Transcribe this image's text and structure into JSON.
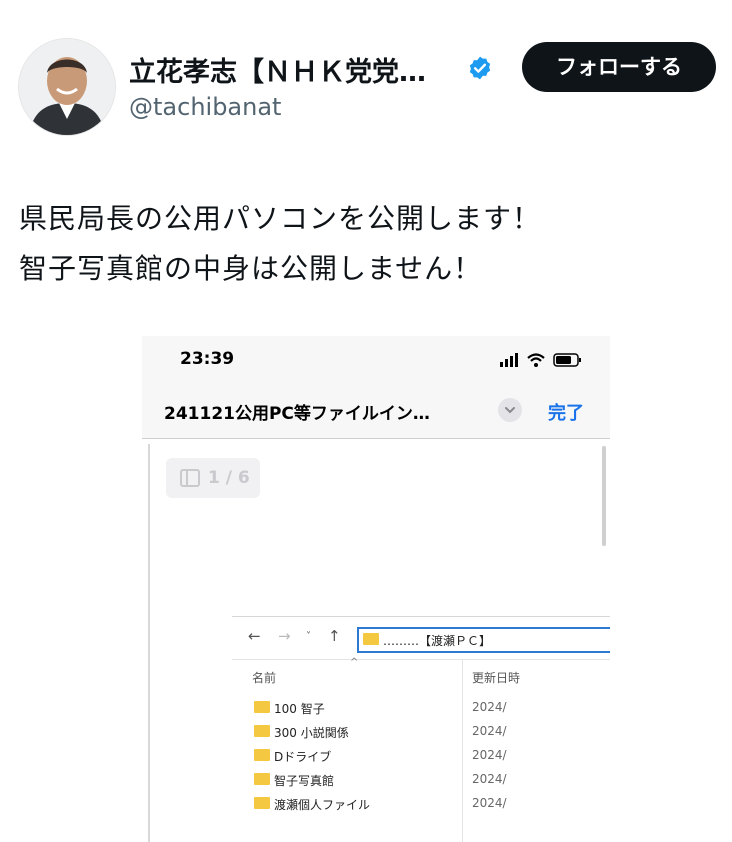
{
  "header": {
    "display_name": "立花孝志【ＮＨＫ党党…",
    "handle": "@tachibanat",
    "follow_label": "フォローする"
  },
  "tweet": {
    "line1": "県民局長の公用パソコンを公開します！",
    "line2": "智子写真館の中身は公開しません！"
  },
  "screenshot": {
    "time": "23:39",
    "doc_title": "241121公用PC等ファイルイン…",
    "done_label": "完了",
    "page_indicator": "1 / 6",
    "explorer": {
      "path": "………【渡瀬ＰＣ】",
      "col_name": "名前",
      "col_date": "更新日時",
      "rows": [
        {
          "name": "100 智子",
          "date": "2024/"
        },
        {
          "name": "300 小説関係",
          "date": "2024/"
        },
        {
          "name": "Dドライブ",
          "date": "2024/"
        },
        {
          "name": "智子写真館",
          "date": "2024/"
        },
        {
          "name": "渡瀬個人ファイル",
          "date": "2024/"
        }
      ]
    }
  },
  "colors": {
    "follow_bg": "#0f1419",
    "verified_blue": "#1d9bf0",
    "link_blue": "#1a73e8",
    "folder_yellow": "#f5c842"
  },
  "icons": [
    "verified-badge-icon",
    "signal-icon",
    "wifi-icon",
    "battery-icon",
    "chevron-down-icon",
    "sidebar-icon",
    "folder-icon",
    "back-arrow-icon",
    "forward-arrow-icon",
    "up-arrow-icon"
  ]
}
